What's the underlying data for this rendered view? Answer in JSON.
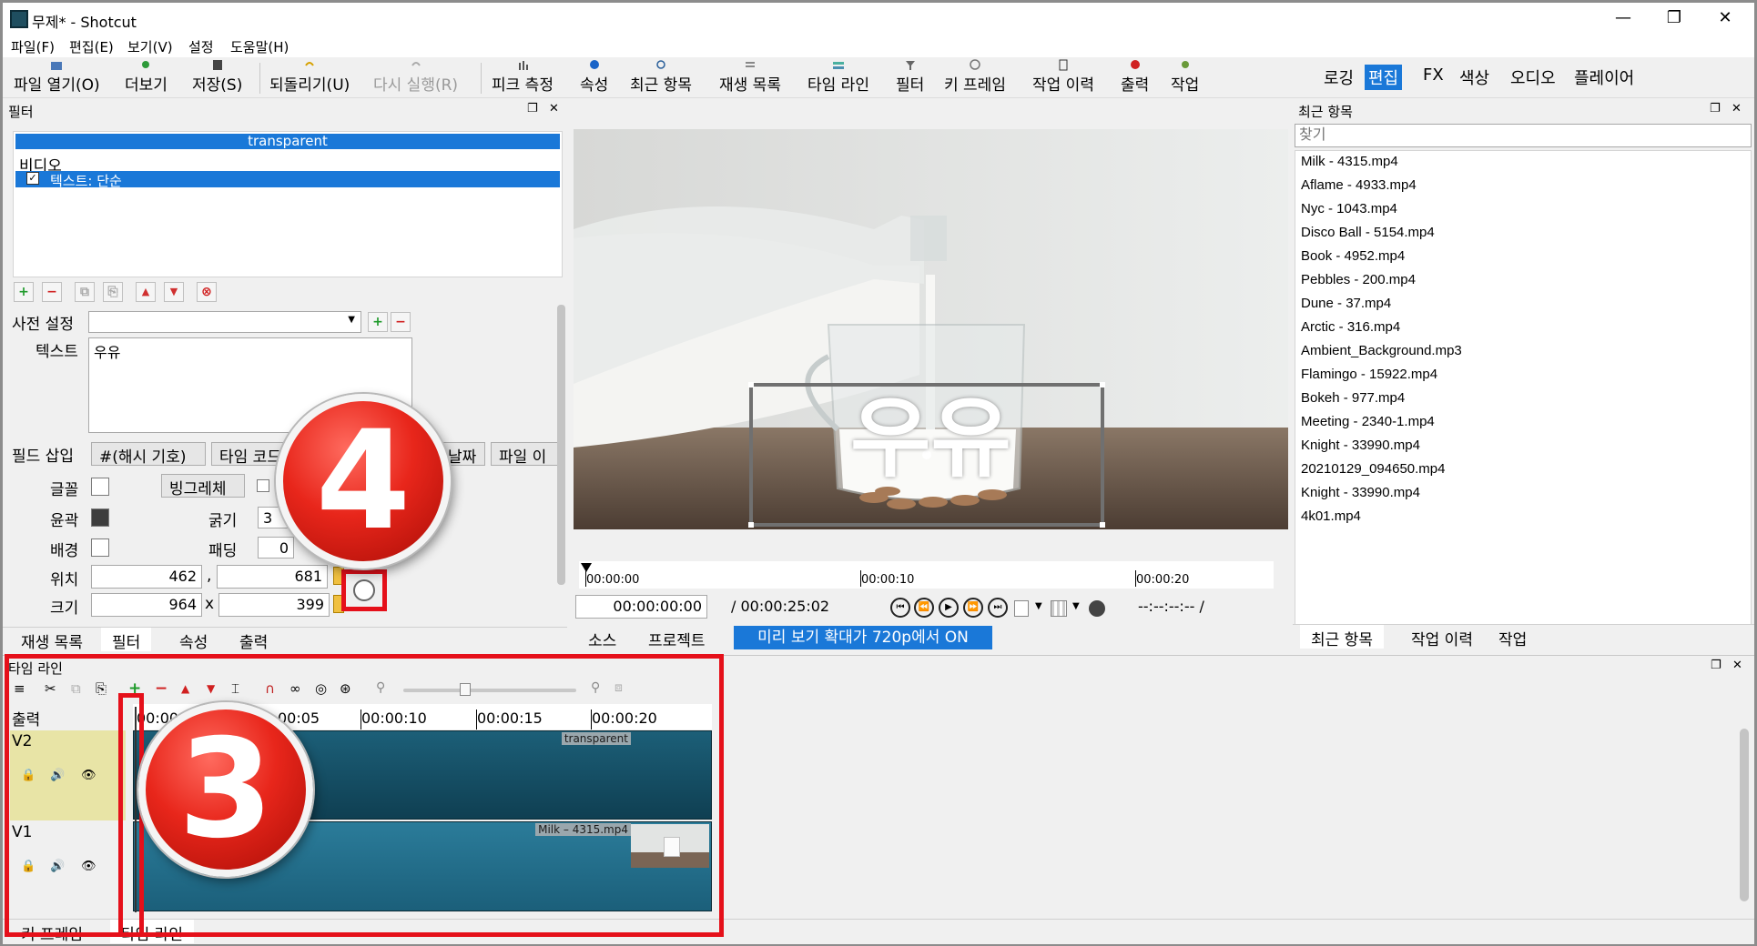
{
  "window": {
    "title": "무제* - Shotcut",
    "minimize": "—",
    "restore": "❐",
    "close": "✕"
  },
  "menu": [
    "파일(F)",
    "편집(E)",
    "보기(V)",
    "설정",
    "도움말(H)"
  ],
  "toolbar": {
    "buttons": [
      {
        "label": "파일 열기(O)",
        "icon": "folder-open-icon",
        "disabled": false
      },
      {
        "label": "더보기",
        "icon": "more-icon",
        "disabled": false
      },
      {
        "label": "저장(S)",
        "icon": "save-icon",
        "disabled": false
      },
      {
        "label": "되돌리기(U)",
        "icon": "undo-icon",
        "disabled": false
      },
      {
        "label": "다시 실행(R)",
        "icon": "redo-icon",
        "disabled": true
      },
      {
        "label": "피크 측정",
        "icon": "peak-meter-icon",
        "disabled": false
      },
      {
        "label": "속성",
        "icon": "info-icon",
        "disabled": false
      },
      {
        "label": "최근 항목",
        "icon": "recent-icon",
        "disabled": false
      },
      {
        "label": "재생 목록",
        "icon": "playlist-icon",
        "disabled": false
      },
      {
        "label": "타임 라인",
        "icon": "timeline-icon",
        "disabled": false
      },
      {
        "label": "필터",
        "icon": "filter-icon",
        "disabled": false
      },
      {
        "label": "키 프레임",
        "icon": "keyframe-icon",
        "disabled": false
      },
      {
        "label": "작업 이력",
        "icon": "history-icon",
        "disabled": false
      },
      {
        "label": "출력",
        "icon": "export-icon",
        "disabled": false
      },
      {
        "label": "작업",
        "icon": "jobs-icon",
        "disabled": false
      }
    ],
    "layouts": [
      "로깅",
      "편집",
      "FX",
      "색상",
      "오디오",
      "플레이어"
    ],
    "active_layout": "편집"
  },
  "filter_panel": {
    "title": "필터",
    "current_clip": "transparent",
    "group_label": "비디오",
    "filter_item": "텍스트: 단순",
    "preset_label": "사전 설정",
    "text_label": "텍스트",
    "text_value": "우유",
    "insert_field_label": "필드 삽입",
    "insert_buttons": [
      "#(해시 기호)",
      "타임 코드",
      "날짜",
      "파일 이"
    ],
    "font_label": "글꼴",
    "font_button": "빙그레체",
    "outline_label": "윤곽",
    "thickness_label": "굵기",
    "thickness_value": "3",
    "bg_label": "배경",
    "padding_label": "패딩",
    "padding_value": "0",
    "position_label": "위치",
    "pos_x": "462",
    "pos_sep": ",",
    "pos_y": "681",
    "size_label": "크기",
    "size_w": "964",
    "size_sep": "x",
    "size_h": "399"
  },
  "left_tabs": [
    "재생 목록",
    "필터",
    "속성",
    "출력"
  ],
  "left_active_tab": "필터",
  "player": {
    "overlay_text": "우유",
    "ruler": [
      "00:00:00",
      "00:00:10",
      "00:00:20"
    ],
    "timecode": "00:00:00:00",
    "duration": "/ 00:00:25:02",
    "inout": "--:--:--:-- /",
    "tabs": [
      "소스",
      "프로젝트"
    ],
    "zoom_notice": "미리 보기 확대가 720p에서 ON"
  },
  "recent_panel": {
    "title": "최근 항목",
    "search_placeholder": "찾기",
    "items": [
      "Milk - 4315.mp4",
      "Aflame - 4933.mp4",
      "Nyc - 1043.mp4",
      "Disco Ball - 5154.mp4",
      "Book - 4952.mp4",
      "Pebbles - 200.mp4",
      "Dune - 37.mp4",
      "Arctic - 316.mp4",
      "Ambient_Background.mp3",
      "Flamingo - 15922.mp4",
      "Bokeh - 977.mp4",
      "Meeting - 2340-1.mp4",
      "Knight - 33990.mp4",
      "20210129_094650.mp4",
      "Knight - 33990.mp4",
      "4k01.mp4"
    ],
    "tabs": [
      "최근 항목",
      "작업 이력",
      "작업"
    ]
  },
  "timeline": {
    "title": "타임 라인",
    "output_label": "출력",
    "ruler": [
      "00:00",
      "00:05",
      "00:00:10",
      "00:00:15",
      "00:00:20"
    ],
    "tracks": [
      {
        "name": "V2",
        "clip": "transparent"
      },
      {
        "name": "V1",
        "clip": "Milk – 4315.mp4"
      }
    ],
    "bottom_tabs": [
      "키 프레임",
      "타임 라인"
    ]
  },
  "annotations": {
    "badge_a": "4",
    "badge_b": "3"
  },
  "colors": {
    "accent": "#1a78d8",
    "highlight_red": "#e5101a",
    "track_header_selected": "#e8e4a6",
    "clip_dark": "#12475a",
    "clip_light": "#1c6a86"
  }
}
